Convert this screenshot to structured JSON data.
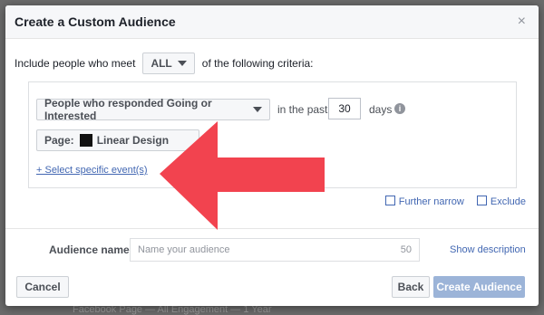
{
  "backdrop": {
    "bottom_text": "Facebook Page — All Engagement — 1 Year"
  },
  "modal": {
    "title": "Create a Custom Audience",
    "close_glyph": "×"
  },
  "criteria": {
    "include_prefix": "Include people who meet",
    "match_value": "ALL",
    "include_suffix": "of the following criteria:",
    "response_option": "People who responded Going or Interested",
    "in_the_past": "in the past",
    "days_value": "30",
    "days_label": "days",
    "page_label": "Page:",
    "page_name": "Linear Design",
    "select_events_link": "+ Select specific event(s)"
  },
  "actions": {
    "further_narrow": "Further narrow",
    "exclude": "Exclude"
  },
  "audience": {
    "label": "Audience name",
    "placeholder": "Name your audience",
    "char_limit": "50",
    "show_description": "Show description"
  },
  "footer": {
    "cancel": "Cancel",
    "back": "Back",
    "create": "Create Audience"
  },
  "colors": {
    "link": "#4267b2",
    "arrow": "#f2434f",
    "create_disabled": "#9cb4d8"
  }
}
